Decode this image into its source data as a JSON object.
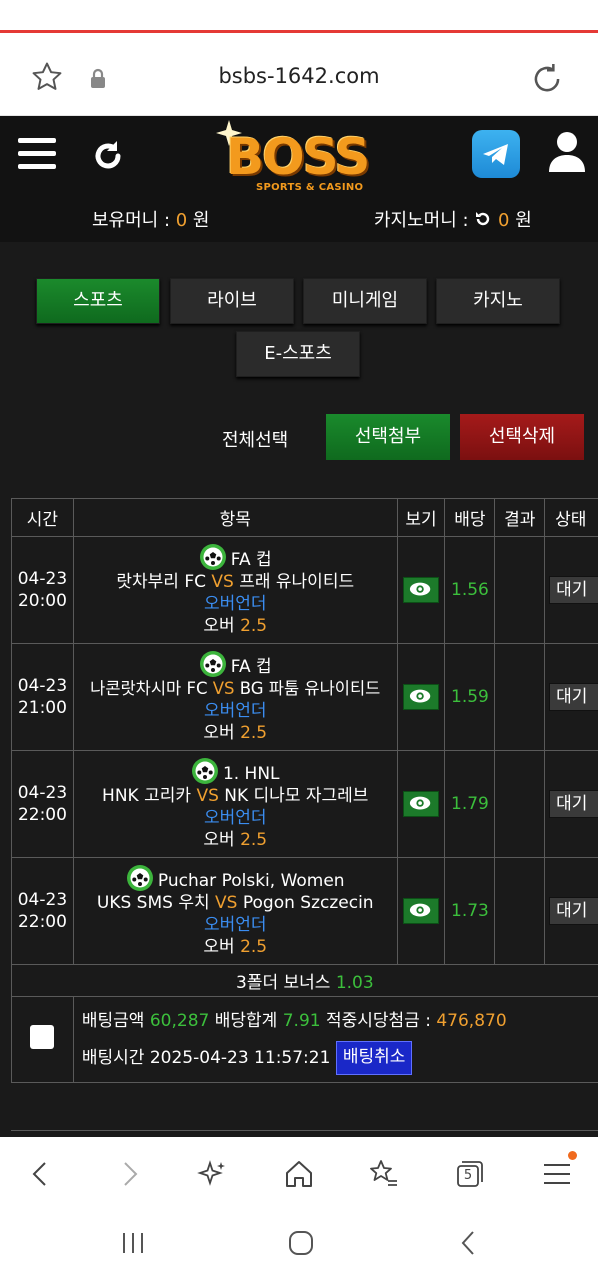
{
  "browser": {
    "url": "bsbs-1642.com",
    "tab_count": "5"
  },
  "header": {
    "logo_text": "BOSS",
    "logo_sub": "SPORTS & CASINO",
    "cash_label": "보유머니 : ",
    "cash_value": "0",
    "cash_unit": " 원",
    "casino_label": "카지노머니 : ",
    "casino_value": "0",
    "casino_unit": " 원"
  },
  "tabs": [
    "스포츠",
    "라이브",
    "미니게임",
    "카지노",
    "E-스포츠"
  ],
  "actions": {
    "select_all": "전체선택",
    "attach": "선택첨부",
    "delete": "선택삭제"
  },
  "table": {
    "headers": [
      "시간",
      "항목",
      "보기",
      "배당",
      "결과",
      "상태"
    ],
    "rows": [
      {
        "date": "04-23",
        "time": "20:00",
        "league": "FA 컵",
        "home": "랏차부리 FC",
        "vs": "VS",
        "away": "프래 유나이티드",
        "market": "오버언더",
        "pick": "오버",
        "line": "2.5",
        "odds": "1.56",
        "status": "대기"
      },
      {
        "date": "04-23",
        "time": "21:00",
        "league": "FA 컵",
        "home": "나콘랏차시마 FC",
        "vs": "VS",
        "away": "BG 파툼 유나이티드",
        "market": "오버언더",
        "pick": "오버",
        "line": "2.5",
        "odds": "1.59",
        "status": "대기"
      },
      {
        "date": "04-23",
        "time": "22:00",
        "league": "1. HNL",
        "home": "HNK 고리카",
        "vs": "VS",
        "away": "NK 디나모 자그레브",
        "market": "오버언더",
        "pick": "오버",
        "line": "2.5",
        "odds": "1.79",
        "status": "대기"
      },
      {
        "date": "04-23",
        "time": "22:00",
        "league": "Puchar Polski, Women",
        "home": "UKS SMS 우치",
        "vs": "VS",
        "away": "Pogon Szczecin",
        "market": "오버언더",
        "pick": "오버",
        "line": "2.5",
        "odds": "1.73",
        "status": "대기"
      }
    ],
    "bonus_label": "3폴더 보너스 ",
    "bonus_value": "1.03",
    "summary": {
      "bet_amount_label": "배팅금액 ",
      "bet_amount": "60,287",
      "odds_total_label": " 배당합계 ",
      "odds_total": "7.91",
      "payout_label": " 적중시당첨금 : ",
      "payout": "476,870",
      "bet_time_label": "배팅시간 ",
      "bet_time": "2025-04-23 11:57:21",
      "cancel": "배팅취소"
    }
  },
  "colors": {
    "accent_green": "#1b8a2c",
    "accent_red": "#a51a1a",
    "odds_green": "#3cbf3c",
    "orange": "#f0a030",
    "blue_link": "#3b8df0"
  }
}
